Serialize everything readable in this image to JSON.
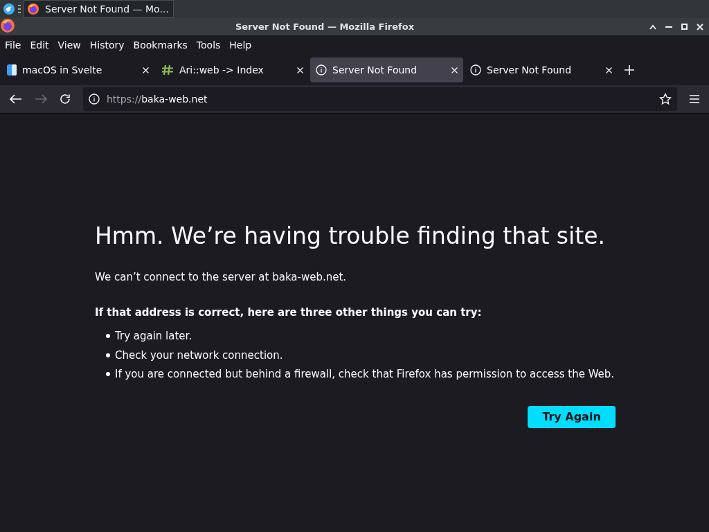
{
  "taskbar": {
    "task": {
      "title": "Server Not Found — Mo...",
      "selected": true
    }
  },
  "window": {
    "title": "Server Not Found — Mozilla Firefox"
  },
  "menu": [
    "File",
    "Edit",
    "View",
    "History",
    "Bookmarks",
    "Tools",
    "Help"
  ],
  "tabs": [
    {
      "label": "macOS in Svelte",
      "kind": "favicon",
      "selected": false
    },
    {
      "label": "Ari::web -> Index",
      "kind": "hash",
      "selected": false
    },
    {
      "label": "Server Not Found",
      "kind": "error",
      "selected": true
    },
    {
      "label": "Server Not Found",
      "kind": "error",
      "selected": false
    }
  ],
  "nav": {
    "forward_disabled": true,
    "url_scheme": "https://",
    "url_host": "baka-web.net"
  },
  "error": {
    "heading": "Hmm. We’re having trouble finding that site.",
    "message": "We can’t connect to the server at baka-web.net.",
    "subheading": "If that address is correct, here are three other things you can try:",
    "tips": [
      "Try again later.",
      "Check your network connection.",
      "If you are connected but behind a firewall, check that Firefox has permission to access the Web."
    ],
    "button": "Try Again"
  }
}
